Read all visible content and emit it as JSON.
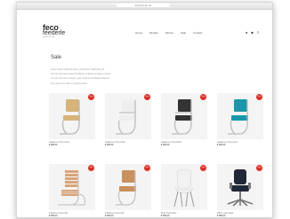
{
  "browser": {
    "url": "fecodesign.de"
  },
  "site": {
    "logo_main": "feco",
    "logo_sub": "feederle",
    "logo_tag": "design furniture"
  },
  "nav": [
    "Home",
    "Models",
    "Stories",
    "Sale",
    "Contact"
  ],
  "page": {
    "title": "Sale",
    "intro": [
      "Lorem ipsum dolor sit amet, consectetur adipiscing elit.",
      "Sed do eiusmod tempor incididunt ut labore et dolore magna.",
      "Ut enim ad minim veniam, quis nostrud exercitation ullamco.",
      "Duis aute irure dolor in reprehenderit."
    ]
  },
  "colors": {
    "badge": "#d93228"
  },
  "products": [
    {
      "name": "Cantilever chair wood",
      "price": "€ 000,00",
      "badge": "Sale",
      "seat": "#d7b37a",
      "frame": "#b9b9b9",
      "type": "cantilever"
    },
    {
      "name": "Cantilever chair white",
      "price": "€ 000,00",
      "badge": "Sale",
      "seat": "#eeeeee",
      "frame": "#bcbcbc",
      "type": "cantilever-arms"
    },
    {
      "name": "Cantilever chair black",
      "price": "€ 000,00",
      "badge": "Sale",
      "seat": "#333333",
      "frame": "#bdbdbd",
      "type": "cantilever-arms"
    },
    {
      "name": "Cantilever chair petrol",
      "price": "€ 000,00",
      "badge": "Sale",
      "seat": "#1b97a9",
      "frame": "#bdbdbd",
      "type": "cantilever"
    },
    {
      "name": "Cantilever chair slat",
      "price": "€ 000,00",
      "badge": "Sale",
      "seat": "#d9a478",
      "frame": "#c8c8c8",
      "type": "slat"
    },
    {
      "name": "Cantilever chair oak",
      "price": "€ 000,00",
      "badge": "Sale",
      "seat": "#c9915f",
      "frame": "#c4c4c4",
      "type": "cantilever"
    },
    {
      "name": "Shell chair white",
      "price": "€ 000,00",
      "badge": "Sale",
      "seat": "#f2f2f2",
      "frame": "#9a9a9a",
      "type": "shell"
    },
    {
      "name": "Office chair black",
      "price": "€ 000,00",
      "badge": "Sale",
      "seat": "#202838",
      "frame": "#777777",
      "type": "office"
    }
  ]
}
